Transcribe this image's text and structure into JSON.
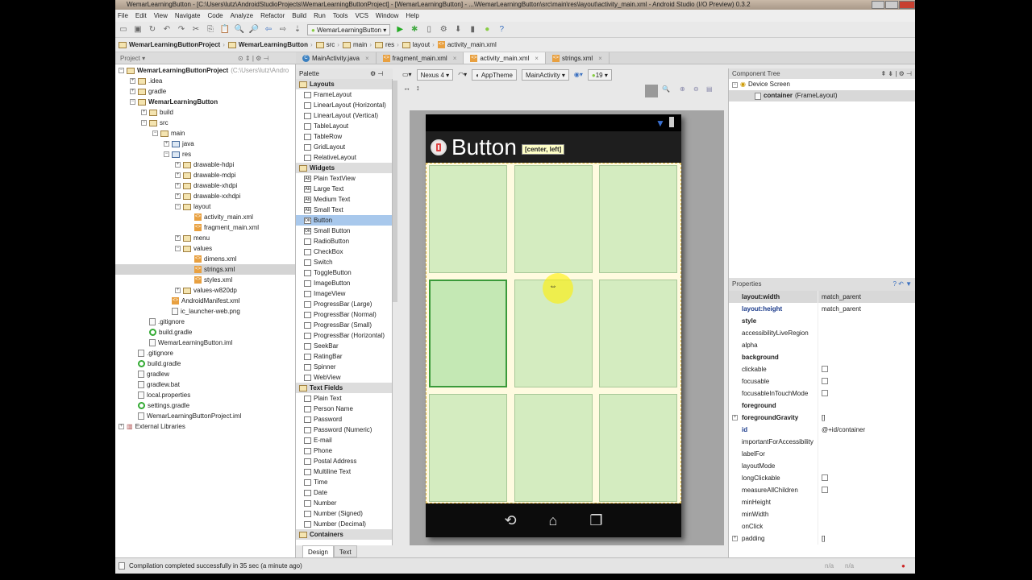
{
  "window": {
    "title": "WemarLearningButton - [C:\\Users\\lutz\\AndroidStudioProjects\\WemarLearningButtonProject] - [WemarLearningButton] - ...\\WemarLearningButton\\src\\main\\res\\layout\\activity_main.xml - Android Studio (I/O Preview) 0.3.2"
  },
  "menu": [
    "File",
    "Edit",
    "View",
    "Navigate",
    "Code",
    "Analyze",
    "Refactor",
    "Build",
    "Run",
    "Tools",
    "VCS",
    "Window",
    "Help"
  ],
  "toolbar": {
    "run_config": "WemarLearningButton",
    "help": "?"
  },
  "breadcrumb": [
    "WemarLearningButtonProject",
    "WemarLearningButton",
    "src",
    "main",
    "res",
    "layout",
    "activity_main.xml"
  ],
  "project_panel": {
    "label": "Project"
  },
  "tabs": [
    "MainActivity.java",
    "fragment_main.xml",
    "activity_main.xml",
    "strings.xml"
  ],
  "tree": [
    {
      "label": "WemarLearningButtonProject",
      "hint": "(C:\\Users\\lutz\\Andro",
      "depth": 0,
      "icon": "module",
      "bold": true,
      "exp": "-"
    },
    {
      "label": ".idea",
      "depth": 1,
      "icon": "folder",
      "exp": "+"
    },
    {
      "label": "gradle",
      "depth": 1,
      "icon": "folder",
      "exp": "+"
    },
    {
      "label": "WemarLearningButton",
      "depth": 1,
      "icon": "module",
      "bold": true,
      "exp": "-"
    },
    {
      "label": "build",
      "depth": 2,
      "icon": "folder",
      "exp": "+"
    },
    {
      "label": "src",
      "depth": 2,
      "icon": "folder",
      "exp": "-"
    },
    {
      "label": "main",
      "depth": 3,
      "icon": "folder",
      "exp": "-"
    },
    {
      "label": "java",
      "depth": 4,
      "icon": "folder-blue",
      "exp": "+"
    },
    {
      "label": "res",
      "depth": 4,
      "icon": "folder-blue",
      "exp": "-"
    },
    {
      "label": "drawable-hdpi",
      "depth": 5,
      "icon": "folder",
      "exp": "+"
    },
    {
      "label": "drawable-mdpi",
      "depth": 5,
      "icon": "folder",
      "exp": "+"
    },
    {
      "label": "drawable-xhdpi",
      "depth": 5,
      "icon": "folder",
      "exp": "+"
    },
    {
      "label": "drawable-xxhdpi",
      "depth": 5,
      "icon": "folder",
      "exp": "+"
    },
    {
      "label": "layout",
      "depth": 5,
      "icon": "folder",
      "exp": "-"
    },
    {
      "label": "activity_main.xml",
      "depth": 6,
      "icon": "xml"
    },
    {
      "label": "fragment_main.xml",
      "depth": 6,
      "icon": "xml"
    },
    {
      "label": "menu",
      "depth": 5,
      "icon": "folder",
      "exp": "+"
    },
    {
      "label": "values",
      "depth": 5,
      "icon": "folder",
      "exp": "-"
    },
    {
      "label": "dimens.xml",
      "depth": 6,
      "icon": "xml"
    },
    {
      "label": "strings.xml",
      "depth": 6,
      "icon": "xml",
      "selected": true
    },
    {
      "label": "styles.xml",
      "depth": 6,
      "icon": "xml"
    },
    {
      "label": "values-w820dp",
      "depth": 5,
      "icon": "folder",
      "exp": "+"
    },
    {
      "label": "AndroidManifest.xml",
      "depth": 4,
      "icon": "xml"
    },
    {
      "label": "ic_launcher-web.png",
      "depth": 4,
      "icon": "file"
    },
    {
      "label": ".gitignore",
      "depth": 2,
      "icon": "file"
    },
    {
      "label": "build.gradle",
      "depth": 2,
      "icon": "gradle"
    },
    {
      "label": "WemarLearningButton.iml",
      "depth": 2,
      "icon": "file"
    },
    {
      "label": ".gitignore",
      "depth": 1,
      "icon": "file"
    },
    {
      "label": "build.gradle",
      "depth": 1,
      "icon": "gradle"
    },
    {
      "label": "gradlew",
      "depth": 1,
      "icon": "file"
    },
    {
      "label": "gradlew.bat",
      "depth": 1,
      "icon": "file"
    },
    {
      "label": "local.properties",
      "depth": 1,
      "icon": "file"
    },
    {
      "label": "settings.gradle",
      "depth": 1,
      "icon": "gradle"
    },
    {
      "label": "WemarLearningButtonProject.iml",
      "depth": 1,
      "icon": "file"
    },
    {
      "label": "External Libraries",
      "depth": 0,
      "icon": "library",
      "exp": "+"
    }
  ],
  "palette": {
    "title": "Palette",
    "groups": [
      {
        "name": "Layouts",
        "items": [
          "FrameLayout",
          "LinearLayout (Horizontal)",
          "LinearLayout (Vertical)",
          "TableLayout",
          "TableRow",
          "GridLayout",
          "RelativeLayout"
        ]
      },
      {
        "name": "Widgets",
        "items": [
          "Plain TextView",
          "Large Text",
          "Medium Text",
          "Small Text",
          "Button",
          "Small Button",
          "RadioButton",
          "CheckBox",
          "Switch",
          "ToggleButton",
          "ImageButton",
          "ImageView",
          "ProgressBar (Large)",
          "ProgressBar (Normal)",
          "ProgressBar (Small)",
          "ProgressBar (Horizontal)",
          "SeekBar",
          "RatingBar",
          "Spinner",
          "WebView"
        ]
      },
      {
        "name": "Text Fields",
        "items": [
          "Plain Text",
          "Person Name",
          "Password",
          "Password (Numeric)",
          "E-mail",
          "Phone",
          "Postal Address",
          "Multiline Text",
          "Time",
          "Date",
          "Number",
          "Number (Signed)",
          "Number (Decimal)"
        ]
      },
      {
        "name": "Containers",
        "items": []
      }
    ],
    "selected": "Button"
  },
  "design_tabs": [
    "Design",
    "Text"
  ],
  "canvas_toolbar": {
    "device": "Nexus 4",
    "theme": "AppTheme",
    "activity": "MainActivity",
    "api": "19"
  },
  "preview": {
    "title": "Button",
    "tooltip": "[center, left]",
    "grid_rows": 3,
    "grid_cols": 3,
    "selected_cell": [
      1,
      0
    ]
  },
  "component_tree": {
    "title": "Component Tree",
    "root": "Device Screen",
    "child_name": "container",
    "child_type": "(FrameLayout)"
  },
  "properties": {
    "title": "Properties",
    "rows": [
      {
        "name": "layout:width",
        "value": "match_parent",
        "style": "bold",
        "selected": true
      },
      {
        "name": "layout:height",
        "value": "match_parent",
        "style": "blue"
      },
      {
        "name": "style",
        "value": "",
        "style": "bold"
      },
      {
        "name": "accessibilityLiveRegion",
        "value": ""
      },
      {
        "name": "alpha",
        "value": ""
      },
      {
        "name": "background",
        "value": "",
        "style": "bold"
      },
      {
        "name": "clickable",
        "value": "",
        "checkbox": true
      },
      {
        "name": "focusable",
        "value": "",
        "checkbox": true
      },
      {
        "name": "focusableInTouchMode",
        "value": "",
        "checkbox": true
      },
      {
        "name": "foreground",
        "value": "",
        "style": "bold"
      },
      {
        "name": "foregroundGravity",
        "value": "[]",
        "style": "bold",
        "exp": true
      },
      {
        "name": "id",
        "value": "@+id/container",
        "style": "blue"
      },
      {
        "name": "importantForAccessibility",
        "value": ""
      },
      {
        "name": "labelFor",
        "value": ""
      },
      {
        "name": "layoutMode",
        "value": ""
      },
      {
        "name": "longClickable",
        "value": "",
        "checkbox": true
      },
      {
        "name": "measureAllChildren",
        "value": "",
        "checkbox": true
      },
      {
        "name": "minHeight",
        "value": ""
      },
      {
        "name": "minWidth",
        "value": ""
      },
      {
        "name": "onClick",
        "value": ""
      },
      {
        "name": "padding",
        "value": "[]",
        "exp": true
      }
    ]
  },
  "statusbar": {
    "message": "Compilation completed successfully in 35 sec (a minute ago)",
    "indicators": [
      "n/a",
      "n/a"
    ]
  }
}
